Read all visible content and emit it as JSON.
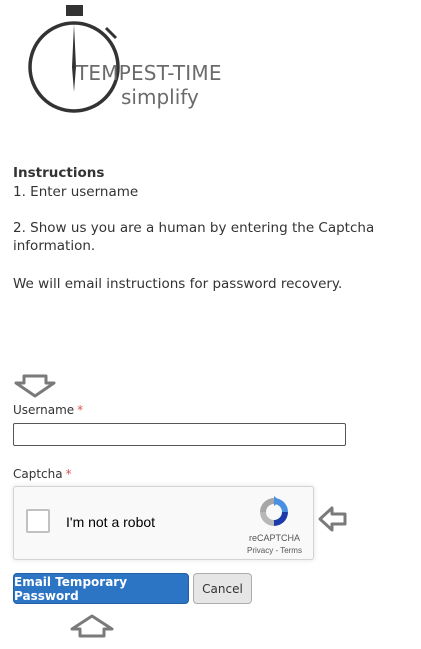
{
  "logo": {
    "line1": "TEMPEST-TIME",
    "line2": "simplify"
  },
  "instructions": {
    "title": "Instructions",
    "step1": "1. Enter username",
    "step2": "2. Show us you are a human by entering the Captcha information.",
    "note": "We will email instructions for password recovery."
  },
  "form": {
    "username_label": "Username",
    "captcha_label": "Captcha",
    "required_mark": "*",
    "username_value": ""
  },
  "captcha": {
    "checkbox_label": "I'm not a robot",
    "brand": "reCAPTCHA",
    "links": "Privacy - Terms"
  },
  "buttons": {
    "email": "Email Temporary Password",
    "cancel": "Cancel"
  },
  "colors": {
    "primary": "#2c74c4",
    "required": "#d9534f",
    "hint_arrow": "#7a7a7a"
  },
  "icons": [
    "stopwatch-logo",
    "arrow-down-icon",
    "arrow-left-icon",
    "arrow-up-icon",
    "recaptcha-logo-icon"
  ]
}
